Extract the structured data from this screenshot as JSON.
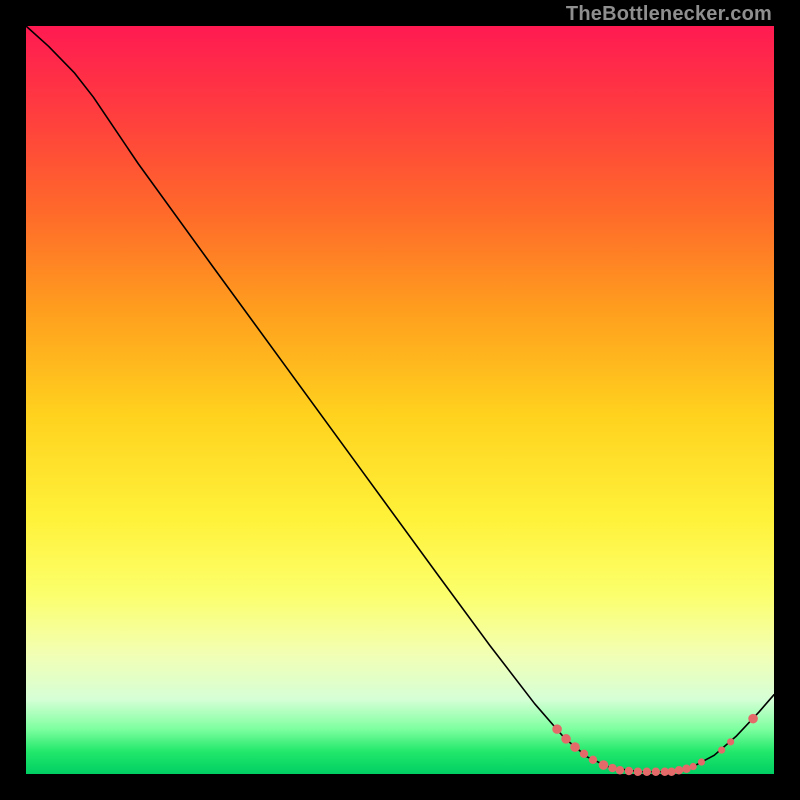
{
  "attribution": "TheBottlenecker.com",
  "colors": {
    "dot_fill": "#e46a6a",
    "curve_stroke": "#000000"
  },
  "chart_data": {
    "type": "line",
    "title": "",
    "xlabel": "",
    "ylabel": "",
    "xlim": [
      0,
      100
    ],
    "ylim": [
      0,
      100
    ],
    "grid": false,
    "legend": false,
    "series": [
      {
        "name": "curve",
        "points": [
          {
            "x": 0.0,
            "y": 100.0
          },
          {
            "x": 3.0,
            "y": 97.3
          },
          {
            "x": 6.5,
            "y": 93.7
          },
          {
            "x": 9.0,
            "y": 90.5
          },
          {
            "x": 15.0,
            "y": 81.6
          },
          {
            "x": 25.0,
            "y": 67.8
          },
          {
            "x": 35.0,
            "y": 54.1
          },
          {
            "x": 45.0,
            "y": 40.4
          },
          {
            "x": 55.0,
            "y": 26.7
          },
          {
            "x": 62.0,
            "y": 17.2
          },
          {
            "x": 68.0,
            "y": 9.4
          },
          {
            "x": 72.0,
            "y": 4.8
          },
          {
            "x": 75.0,
            "y": 2.3
          },
          {
            "x": 78.0,
            "y": 0.9
          },
          {
            "x": 82.0,
            "y": 0.3
          },
          {
            "x": 86.0,
            "y": 0.3
          },
          {
            "x": 89.0,
            "y": 0.9
          },
          {
            "x": 92.0,
            "y": 2.5
          },
          {
            "x": 95.0,
            "y": 5.1
          },
          {
            "x": 98.0,
            "y": 8.3
          },
          {
            "x": 100.0,
            "y": 10.6
          }
        ]
      },
      {
        "name": "points",
        "points": [
          {
            "x": 71.0,
            "y": 6.0,
            "r": 4.8
          },
          {
            "x": 72.2,
            "y": 4.7,
            "r": 4.8
          },
          {
            "x": 73.4,
            "y": 3.6,
            "r": 4.8
          },
          {
            "x": 74.6,
            "y": 2.7,
            "r": 4.2
          },
          {
            "x": 75.8,
            "y": 1.9,
            "r": 4.2
          },
          {
            "x": 77.2,
            "y": 1.2,
            "r": 4.8
          },
          {
            "x": 78.4,
            "y": 0.8,
            "r": 4.2
          },
          {
            "x": 79.4,
            "y": 0.5,
            "r": 4.2
          },
          {
            "x": 80.6,
            "y": 0.4,
            "r": 4.2
          },
          {
            "x": 81.8,
            "y": 0.3,
            "r": 4.2
          },
          {
            "x": 83.0,
            "y": 0.3,
            "r": 4.2
          },
          {
            "x": 84.2,
            "y": 0.3,
            "r": 4.2
          },
          {
            "x": 85.4,
            "y": 0.3,
            "r": 4.2
          },
          {
            "x": 86.3,
            "y": 0.3,
            "r": 4.2
          },
          {
            "x": 87.3,
            "y": 0.5,
            "r": 4.2
          },
          {
            "x": 88.3,
            "y": 0.7,
            "r": 4.2
          },
          {
            "x": 89.2,
            "y": 1.0,
            "r": 3.6
          },
          {
            "x": 90.3,
            "y": 1.6,
            "r": 3.6
          },
          {
            "x": 93.0,
            "y": 3.2,
            "r": 3.6
          },
          {
            "x": 94.2,
            "y": 4.3,
            "r": 3.6
          },
          {
            "x": 97.2,
            "y": 7.4,
            "r": 4.8
          }
        ]
      }
    ]
  }
}
